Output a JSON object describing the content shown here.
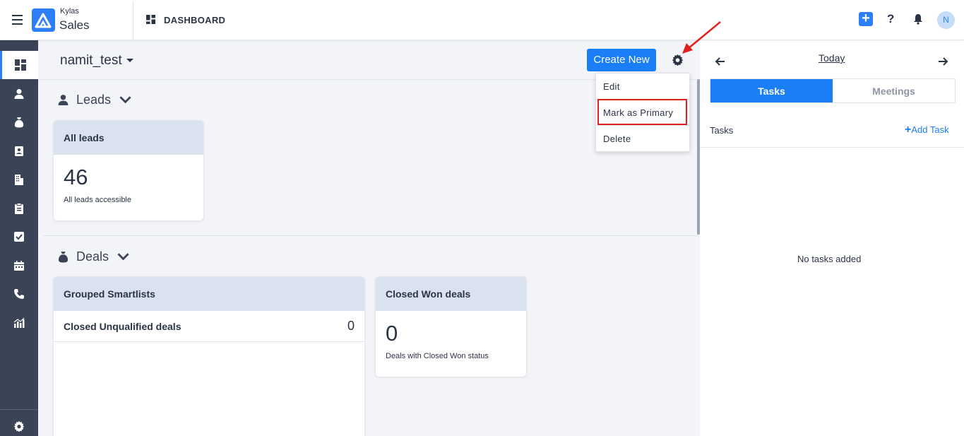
{
  "topbar": {
    "brand_top": "Kylas",
    "brand_bottom": "Sales",
    "page_label": "DASHBOARD",
    "avatar_initial": "N"
  },
  "main": {
    "board_name": "namit_test",
    "create_new_label": "Create New",
    "leads": {
      "title": "Leads",
      "cards": [
        {
          "title": "All leads",
          "value": "46",
          "subtitle": "All leads accessible"
        }
      ]
    },
    "deals": {
      "title": "Deals",
      "grouped": {
        "title": "Grouped Smartlists",
        "rows": [
          {
            "label": "Closed Unqualified deals",
            "count": "0"
          }
        ]
      },
      "won": {
        "title": "Closed Won deals",
        "value": "0",
        "subtitle": "Deals with Closed Won status"
      }
    }
  },
  "dropdown": {
    "items": [
      "Edit",
      "Mark as Primary",
      "Delete"
    ],
    "highlighted": "Mark as Primary"
  },
  "right_panel": {
    "date_label": "Today",
    "tabs": [
      "Tasks",
      "Meetings"
    ],
    "active_tab": "Tasks",
    "section_label": "Tasks",
    "add_label": "Add Task",
    "empty_text": "No tasks added"
  },
  "colors": {
    "accent": "#1a7ef7",
    "sidebar": "#3a4456",
    "card_header": "#d9e2ee",
    "highlight": "#e01f1f"
  }
}
